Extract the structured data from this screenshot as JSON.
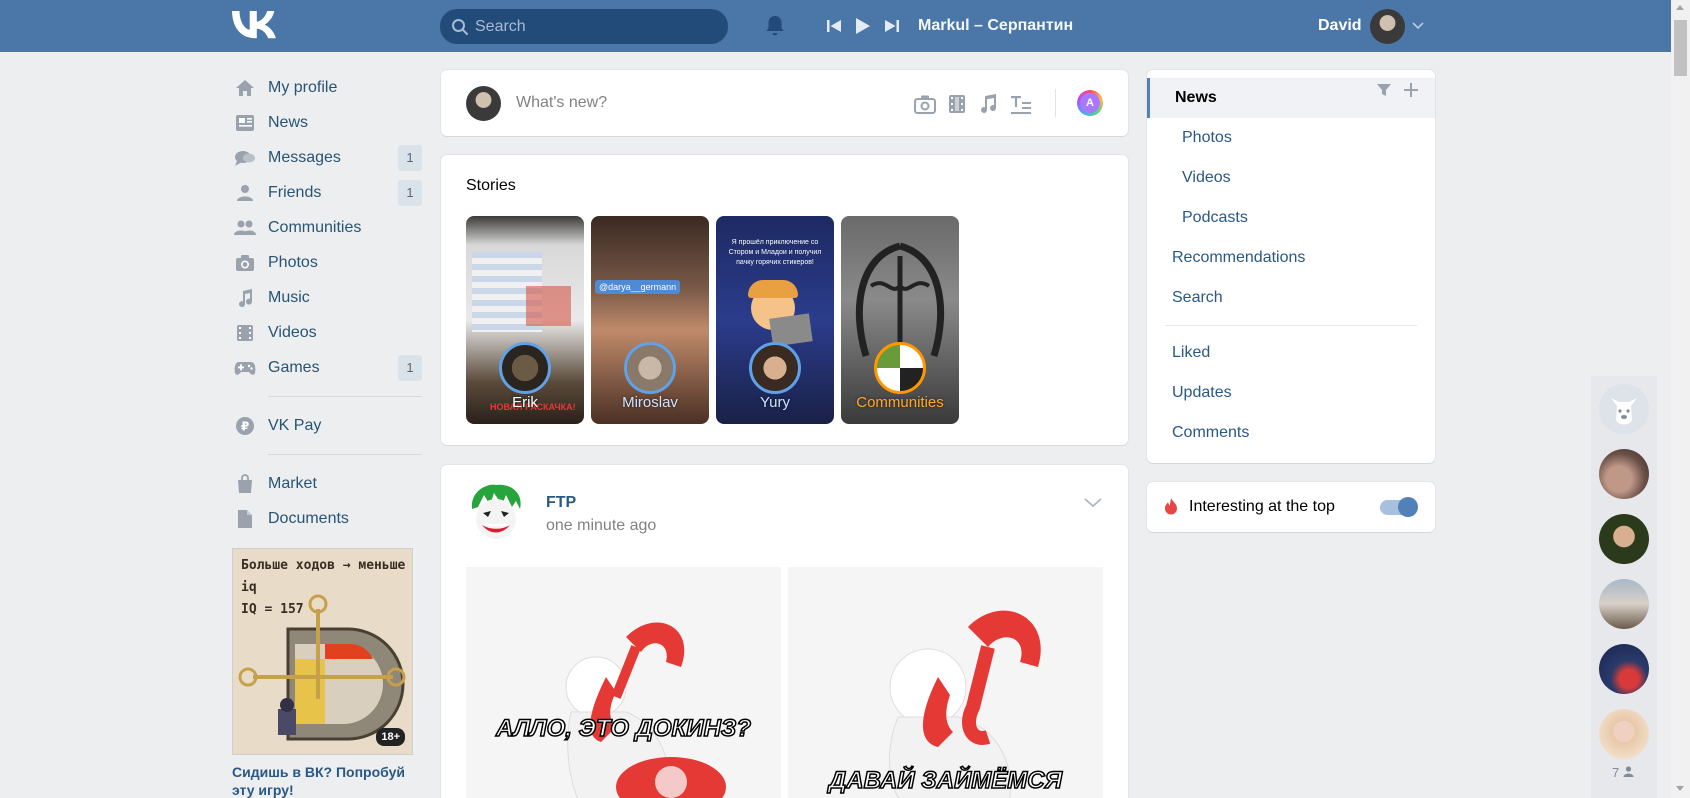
{
  "header": {
    "search_placeholder": "Search",
    "track": "Markul – Серпантин",
    "user_name": "David"
  },
  "leftnav": {
    "items": [
      {
        "label": "My profile",
        "count": ""
      },
      {
        "label": "News",
        "count": ""
      },
      {
        "label": "Messages",
        "count": "1"
      },
      {
        "label": "Friends",
        "count": "1"
      },
      {
        "label": "Communities",
        "count": ""
      },
      {
        "label": "Photos",
        "count": ""
      },
      {
        "label": "Music",
        "count": ""
      },
      {
        "label": "Videos",
        "count": ""
      },
      {
        "label": "Games",
        "count": "1"
      }
    ],
    "vkpay": "VK Pay",
    "market": "Market",
    "documents": "Documents"
  },
  "ad": {
    "title_line1": "Больше ходов → меньше iq",
    "title_line2": "IQ = 157",
    "badge": "18+",
    "caption": "Сидишь в ВК? Попробуй эту игру!"
  },
  "composer": {
    "placeholder": "What's new?",
    "aura_letter": "A"
  },
  "stories": {
    "title": "Stories",
    "items": [
      {
        "name": "Erik"
      },
      {
        "name": "Miroslav"
      },
      {
        "name": "Yury"
      },
      {
        "name": "Communities"
      }
    ],
    "tag_text": "@darya__germann",
    "yury_text": "Я прошёл приключение со Стором и Младои и получил пачку горячих стикеров!",
    "erik_overlay": "НОВАЯ РАСКАЧКА!"
  },
  "post": {
    "author": "FTP",
    "time": "one minute ago",
    "caption_left": "АЛЛО, ЭТО ДОКИНЗ?",
    "caption_right": "ДАВАЙ ЗАЙМЁМСЯ"
  },
  "rightmenu": {
    "items": [
      {
        "label": "News"
      },
      {
        "label": "Photos"
      },
      {
        "label": "Videos"
      },
      {
        "label": "Podcasts"
      },
      {
        "label": "Recommendations"
      },
      {
        "label": "Search"
      },
      {
        "label": "Liked"
      },
      {
        "label": "Updates"
      },
      {
        "label": "Comments"
      }
    ]
  },
  "interesting": {
    "label": "Interesting at the top",
    "enabled": true
  },
  "chats": {
    "online_count": "7"
  },
  "colors": {
    "header": "#4a76a8",
    "link": "#2a5885",
    "accent": "#5181b8"
  }
}
